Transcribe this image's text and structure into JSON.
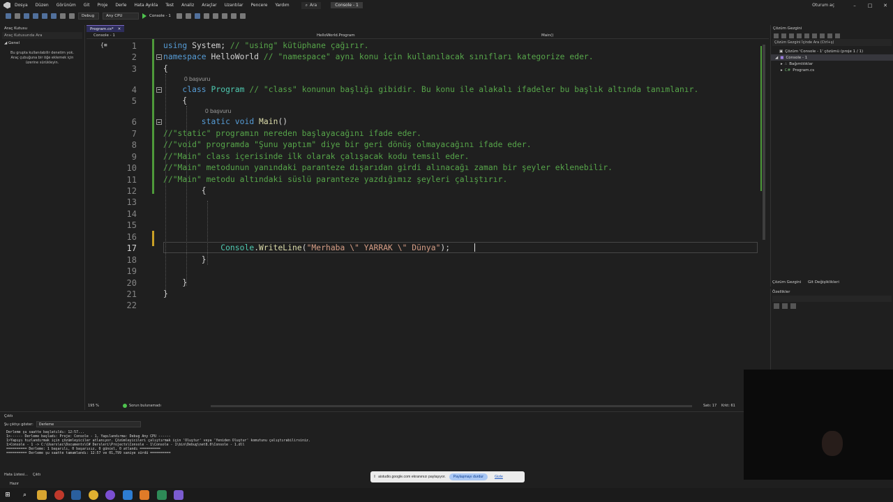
{
  "menubar": {
    "items": [
      "Dosya",
      "Düzen",
      "Görünüm",
      "Git",
      "Proje",
      "Derle",
      "Hata Ayıkla",
      "Test",
      "Analiz",
      "Araçlar",
      "Uzantılar",
      "Pencere",
      "Yardım"
    ],
    "search": "Ara",
    "solution_title": "Console - 1",
    "signin": "Oturum aç"
  },
  "toolbar": {
    "config": "Debug",
    "platform": "Any CPU",
    "run_target": "Console - 1"
  },
  "toolbox": {
    "title": "Araç Kutusu",
    "search_placeholder": "Araç Kutusunda Ara",
    "group": "Genel",
    "empty_message": "Bu grupta kullanılabilir denetim yok. Araç çubuğuna bir öğe eklemek için üzerine sürükleyin."
  },
  "editor": {
    "tab_label": "Program.cs*",
    "nav_project": "Console - 1",
    "nav_class": "HelloWorld.Program",
    "nav_member": "Main()",
    "ref_hint_class": "0 başvuru",
    "ref_hint_method": "0 başvuru",
    "lines": [
      {
        "n": "1",
        "parts": [
          {
            "t": "using ",
            "c": "kw"
          },
          {
            "t": "System; ",
            "c": ""
          },
          {
            "t": "// \"using\" kütüphane çağırır.",
            "c": "cm"
          }
        ]
      },
      {
        "n": "2",
        "parts": [
          {
            "t": "namespace ",
            "c": "kw"
          },
          {
            "t": "HelloWorld ",
            "c": ""
          },
          {
            "t": "// \"namespace\" aynı konu için kullanılacak sınıfları kategorize eder.",
            "c": "cm"
          }
        ]
      },
      {
        "n": "3",
        "parts": [
          {
            "t": "{",
            "c": ""
          }
        ]
      },
      {
        "n": "4",
        "parts": [
          {
            "t": "    class ",
            "c": "kw"
          },
          {
            "t": "Program",
            "c": "cls"
          },
          {
            "t": " ",
            "c": ""
          },
          {
            "t": "// \"class\" konunun başlığı gibidir. Bu konu ile alakalı ifadeler bu başlık altında tanımlanır.",
            "c": "cm"
          }
        ]
      },
      {
        "n": "5",
        "parts": [
          {
            "t": "    {",
            "c": ""
          }
        ]
      },
      {
        "n": "6",
        "parts": [
          {
            "t": "        static ",
            "c": "kw"
          },
          {
            "t": "void ",
            "c": "kw"
          },
          {
            "t": "Main",
            "c": "mt"
          },
          {
            "t": "()",
            "c": ""
          }
        ]
      },
      {
        "n": "7",
        "parts": [
          {
            "t": "//\"static\" programın nereden başlayacağını ifade eder.",
            "c": "cm"
          }
        ]
      },
      {
        "n": "8",
        "parts": [
          {
            "t": "//\"void\" programda \"Şunu yaptım\" diye bir geri dönüş olmayacağını ifade eder.",
            "c": "cm"
          }
        ]
      },
      {
        "n": "9",
        "parts": [
          {
            "t": "//\"Main\" class içerisinde ilk olarak çalışacak kodu temsil eder.",
            "c": "cm"
          }
        ]
      },
      {
        "n": "10",
        "parts": [
          {
            "t": "//\"Main\" metodunun yanındaki paranteze dışarıdan girdi alınacağı zaman bir şeyler eklenebilir.",
            "c": "cm"
          }
        ]
      },
      {
        "n": "11",
        "parts": [
          {
            "t": "//\"Main\" metodu altındaki süslü paranteze yazdığımız şeyleri çalıştırır.",
            "c": "cm"
          }
        ]
      },
      {
        "n": "12",
        "parts": [
          {
            "t": "        {",
            "c": ""
          }
        ]
      },
      {
        "n": "13",
        "parts": []
      },
      {
        "n": "14",
        "parts": []
      },
      {
        "n": "15",
        "parts": []
      },
      {
        "n": "16",
        "parts": []
      },
      {
        "n": "17",
        "parts": [
          {
            "t": "            Console",
            "c": "cls"
          },
          {
            "t": ".",
            "c": ""
          },
          {
            "t": "WriteLine",
            "c": "mt"
          },
          {
            "t": "(",
            "c": ""
          },
          {
            "t": "\"Merhaba \\\" YARRAK \\\" Dünya\"",
            "c": "st"
          },
          {
            "t": ");",
            "c": ""
          }
        ]
      },
      {
        "n": "18",
        "parts": [
          {
            "t": "        }",
            "c": ""
          }
        ]
      },
      {
        "n": "19",
        "parts": []
      },
      {
        "n": "20",
        "parts": [
          {
            "t": "    }",
            "c": ""
          }
        ]
      },
      {
        "n": "21",
        "parts": [
          {
            "t": "}",
            "c": ""
          }
        ]
      },
      {
        "n": "22",
        "parts": []
      }
    ]
  },
  "editor_status": {
    "zoom": "195 %",
    "issues": "Sorun bulunamadı",
    "line": "Satı: 17",
    "col": "Krkt: 61"
  },
  "solution": {
    "title": "Çözüm Gezgini",
    "search_placeholder": "Çözüm Gezgini İçinde Ara (Ctrl+ş)",
    "solution_item": "Çözüm 'Console - 1' çözümü (proje 1 / 1)",
    "project_item": "Console - 1",
    "deps_item": "Bağımlılıklar",
    "file_item": "Program.cs",
    "tab1": "Çözüm Gezgini",
    "tab2": "Git Değişiklikleri"
  },
  "properties": {
    "title": "Özellikler"
  },
  "output": {
    "title": "Çıktı",
    "show_label": "Şu çıktıyı göster:",
    "show_value": "Derleme",
    "lines": "Derleme şu saatte başlatıldı: 12:57...\n1>------ Derleme başladı: Proje: Console - 1, Yapılandırma: Debug Any CPU ------\n1>Yapıyı hızlandırmak için çözümleyiciler atlanıyor. Çözümleyicileri çalıştırmak için 'Oluştur' veya 'Yeniden Oluştur' komutunu çalıştırabilirsiniz.\n1>Console - 1 -> C:\\Users\\ec\\Documents\\C# Dersleri\\Projects\\Console - 1\\Console - 1\\bin\\Debug\\net8.0\\Console - 1.dll\n========== Derleme: 1 başarılı, 0 başarısız, 0 güncel, 0 atlandı ==========\n========== Derleme şu saatte tamamlandı: 12:57 ve 01,799 saniye sürdü =========="
  },
  "bottom_tabs": {
    "error_list": "Hata Listesi...",
    "output": "Çıktı"
  },
  "status": {
    "ready": "Hazır"
  },
  "share_bar": {
    "message": "aistudio.google.com ekranınızı paylaşıyor.",
    "stop": "Paylaşmayı durdur",
    "hide": "Gizle"
  },
  "colors": {
    "keyword": "#569cd6",
    "comment": "#57a64a",
    "type": "#4ec9b0",
    "method": "#dcdcaa",
    "string": "#d69d85"
  }
}
